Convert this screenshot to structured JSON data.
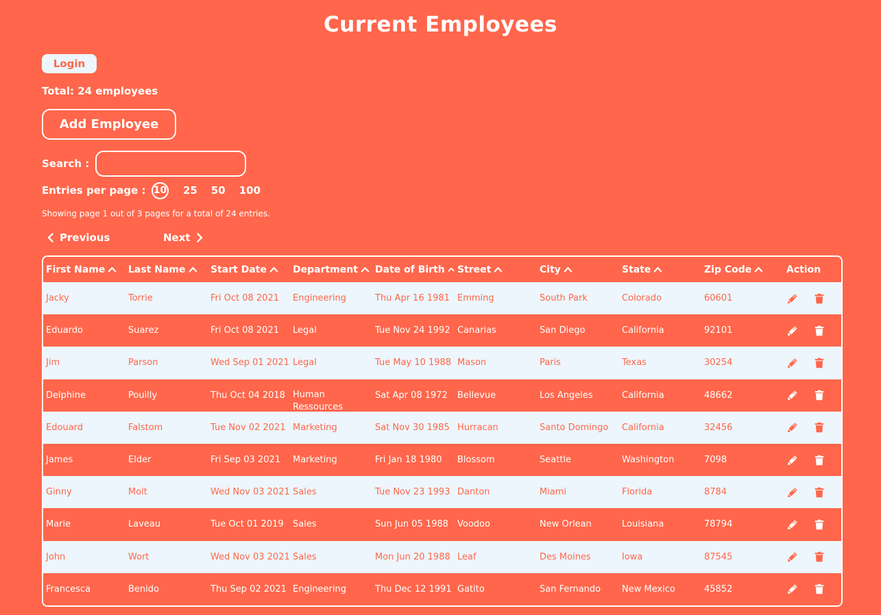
{
  "page_title": "Current Employees",
  "login_label": "Login",
  "total_label": "Total: 24 employees",
  "add_button_label": "Add Employee",
  "search": {
    "label": "Search :",
    "value": "",
    "placeholder": ""
  },
  "entries": {
    "label": "Entries per page :",
    "options": [
      "10",
      "25",
      "50",
      "100"
    ],
    "selected": "10"
  },
  "showing_text": "Showing page 1 out of 3 pages for a total of 24 entries.",
  "pager": {
    "previous_label": "Previous",
    "next_label": "Next"
  },
  "table": {
    "headers": [
      "First Name",
      "Last Name",
      "Start Date",
      "Department",
      "Date of Birth",
      "Street",
      "City",
      "State",
      "Zip Code"
    ],
    "action_header": "Action",
    "rows": [
      [
        "Jacky",
        "Torrie",
        "Fri Oct 08 2021",
        "Engineering",
        "Thu Apr 16 1981",
        "Emming",
        "South Park",
        "Colorado",
        "60601"
      ],
      [
        "Eduardo",
        "Suarez",
        "Fri Oct 08 2021",
        "Legal",
        "Tue Nov 24 1992",
        "Canarias",
        "San Diego",
        "California",
        "92101"
      ],
      [
        "Jim",
        "Parson",
        "Wed Sep 01 2021",
        "Legal",
        "Tue May 10 1988",
        "Mason",
        "Paris",
        "Texas",
        "30254"
      ],
      [
        "Delphine",
        "Pouilly",
        "Thu Oct 04 2018",
        "Human Ressources",
        "Sat Apr 08 1972",
        "Bellevue",
        "Los Angeles",
        "California",
        "48662"
      ],
      [
        "Edouard",
        "Falstom",
        "Tue Nov 02 2021",
        "Marketing",
        "Sat Nov 30 1985",
        "Hurracan",
        "Santo Domingo",
        "California",
        "32456"
      ],
      [
        "James",
        "Elder",
        "Fri Sep 03 2021",
        "Marketing",
        "Fri Jan 18 1980",
        "Blossom",
        "Seattle",
        "Washington",
        "7098"
      ],
      [
        "Ginny",
        "Molt",
        "Wed Nov 03 2021",
        "Sales",
        "Tue Nov 23 1993",
        "Danton",
        "Miami",
        "Florida",
        "8784"
      ],
      [
        "Marie",
        "Laveau",
        "Tue Oct 01 2019",
        "Sales",
        "Sun Jun 05 1988",
        "Voodoo",
        "New Orlean",
        "Louisiana",
        "78794"
      ],
      [
        "John",
        "Wort",
        "Wed Nov 03 2021",
        "Sales",
        "Mon Jun 20 1988",
        "Leaf",
        "Des Moines",
        "Iowa",
        "87545"
      ],
      [
        "Francesca",
        "Benido",
        "Thu Sep 02 2021",
        "Engineering",
        "Thu Dec 12 1991",
        "Gatito",
        "San Fernando",
        "New Mexico",
        "45852"
      ]
    ]
  },
  "icons": {
    "sort": "chevron-up-icon",
    "edit": "pencil-icon",
    "delete": "trash-icon",
    "prev": "chevron-left-icon",
    "next": "chevron-right-icon"
  },
  "colors": {
    "background": "#ff664b",
    "row_light": "#edf6fc",
    "text_light": "#ffffff"
  }
}
